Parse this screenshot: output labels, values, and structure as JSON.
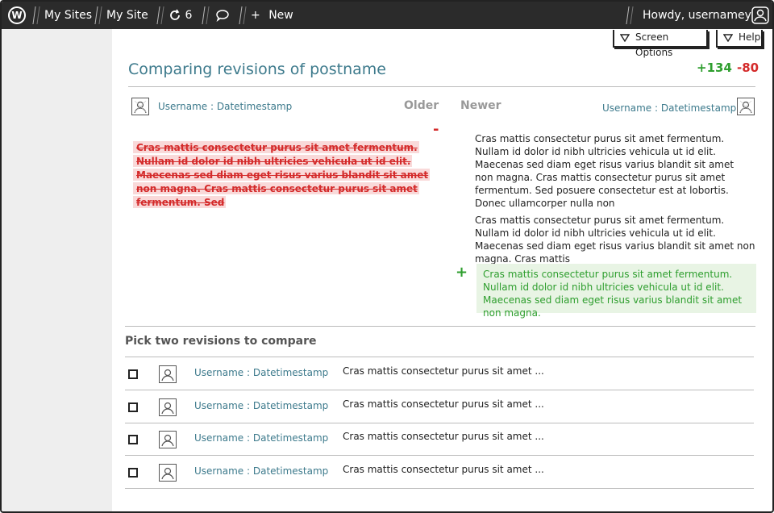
{
  "adminbar": {
    "logo_letter": "W",
    "my_sites": "My Sites",
    "site_name": "My Site",
    "updates_count": "6",
    "new_label": "New",
    "howdy": "Howdy, usernamey"
  },
  "screen_options": {
    "screen_options_label": "Screen Options",
    "help_label": "Help"
  },
  "header": {
    "title": "Comparing revisions of postname",
    "added_count": "+134",
    "removed_count": "-80"
  },
  "compare": {
    "older_user": "Username : Datetimestamp",
    "newer_user": "Username : Datetimestamp",
    "older_label": "Older",
    "newer_label": "Newer",
    "minus_mark": "-",
    "plus_mark": "+",
    "deleted_text": "Cras mattis consectetur purus sit amet fermentum. Nullam id dolor id nibh ultricies vehicula ut id elit. Maecenas sed diam eget risus varius blandit sit amet non magna. Cras mattis consectetur purus sit amet fermentum. Sed",
    "newer_paragraph_1": "Cras mattis consectetur purus sit amet fermentum. Nullam id dolor id nibh ultricies vehicula ut id elit. Maecenas sed diam eget risus varius blandit sit amet non magna. Cras mattis consectetur purus sit amet fermentum. Sed posuere consectetur est at lobortis. Donec ullamcorper nulla non",
    "newer_paragraph_2": "Cras mattis consectetur purus sit amet fermentum. Nullam id dolor id nibh ultricies vehicula ut id elit. Maecenas sed diam eget risus varius blandit sit amet non magna. Cras mattis",
    "added_text": "Cras mattis consectetur purus sit amet fermentum. Nullam id dolor id nibh ultricies vehicula ut id elit. Maecenas sed diam eget risus varius blandit sit amet non magna."
  },
  "revisions": {
    "title": "Pick two revisions to compare",
    "rows": [
      {
        "user": "Username : Datetimestamp",
        "excerpt": "Cras mattis consectetur purus sit amet ..."
      },
      {
        "user": "Username : Datetimestamp",
        "excerpt": "Cras mattis consectetur purus sit amet ..."
      },
      {
        "user": "Username : Datetimestamp",
        "excerpt": "Cras mattis consectetur purus sit amet ..."
      },
      {
        "user": "Username : Datetimestamp",
        "excerpt": "Cras mattis consectetur purus sit amet ..."
      }
    ]
  },
  "colors": {
    "accent_link": "#3d7a8c",
    "added": "#2e9e2e",
    "removed": "#d42a2a",
    "adminbar": "#2b2b2b"
  },
  "icons": {
    "logo": "wordpress-logo-icon",
    "updates": "refresh-icon",
    "comments": "speech-bubble-icon",
    "new": "plus-icon",
    "user": "user-avatar-icon",
    "dropdown": "triangle-down-icon"
  }
}
